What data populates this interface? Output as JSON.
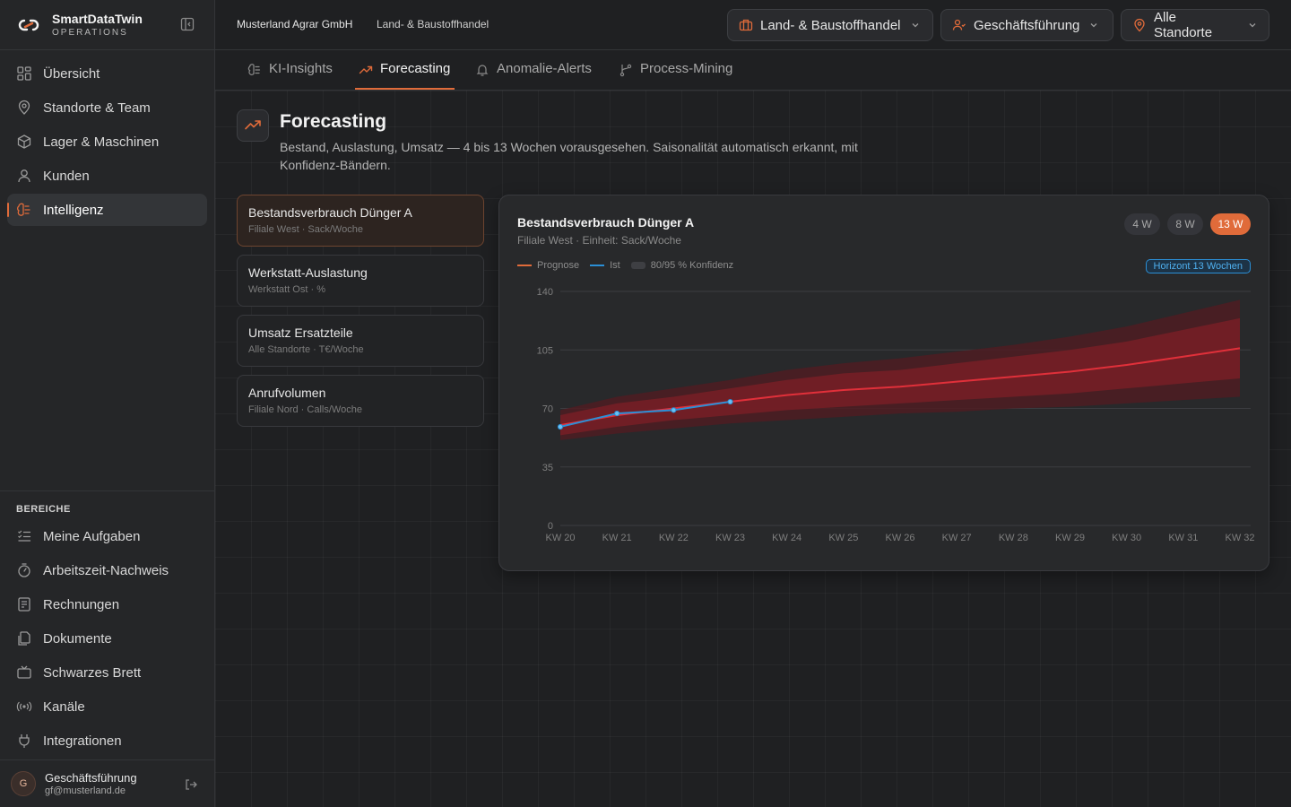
{
  "brand": {
    "name": "SmartDataTwin",
    "sub": "OPERATIONS"
  },
  "sidebar": {
    "items": [
      {
        "label": "Übersicht",
        "icon": "grid-icon"
      },
      {
        "label": "Standorte & Team",
        "icon": "map-pin-icon"
      },
      {
        "label": "Lager & Maschinen",
        "icon": "box-icon"
      },
      {
        "label": "Kunden",
        "icon": "user-icon"
      },
      {
        "label": "Intelligenz",
        "icon": "brain-icon",
        "active": true
      }
    ],
    "section_label": "BEREICHE",
    "section_items": [
      {
        "label": "Meine Aufgaben",
        "icon": "checklist-icon"
      },
      {
        "label": "Arbeitszeit-Nachweis",
        "icon": "timer-icon"
      },
      {
        "label": "Rechnungen",
        "icon": "receipt-icon"
      },
      {
        "label": "Dokumente",
        "icon": "documents-icon"
      },
      {
        "label": "Schwarzes Brett",
        "icon": "board-icon"
      },
      {
        "label": "Kanäle",
        "icon": "broadcast-icon"
      },
      {
        "label": "Integrationen",
        "icon": "plug-icon"
      }
    ],
    "user": {
      "initial": "G",
      "name": "Geschäftsführung",
      "email": "gf@musterland.de"
    }
  },
  "header": {
    "company": "Musterland Agrar GmbH",
    "segment": "Land- & Baustoffhandel",
    "selectors": {
      "branch": "Land- & Baustoffhandel",
      "role": "Geschäftsführung",
      "location": "Alle Standorte"
    }
  },
  "tabs": [
    {
      "label": "KI-Insights",
      "icon": "brain-icon"
    },
    {
      "label": "Forecasting",
      "icon": "trend-icon",
      "active": true
    },
    {
      "label": "Anomalie-Alerts",
      "icon": "bell-icon"
    },
    {
      "label": "Process-Mining",
      "icon": "git-branch-icon"
    }
  ],
  "page": {
    "title": "Forecasting",
    "description": "Bestand, Auslastung, Umsatz — 4 bis 13 Wochen vorausgesehen. Saisonalität automatisch erkannt, mit Konfidenz-Bändern."
  },
  "series_list": [
    {
      "title": "Bestandsverbrauch Dünger A",
      "sub": "Filiale West · Sack/Woche",
      "active": true
    },
    {
      "title": "Werkstatt-Auslastung",
      "sub": "Werkstatt Ost · %"
    },
    {
      "title": "Umsatz Ersatzteile",
      "sub": "Alle Standorte · T€/Woche"
    },
    {
      "title": "Anrufvolumen",
      "sub": "Filiale Nord · Calls/Woche"
    }
  ],
  "chart_panel": {
    "title": "Bestandsverbrauch Dünger A",
    "subtitle": "Filiale West · Einheit: Sack/Woche",
    "horizons": [
      "4 W",
      "8 W",
      "13 W"
    ],
    "active_horizon": "13 W",
    "horizon_badge": "Horizont 13 Wochen",
    "legend": {
      "forecast": "Prognose",
      "actual": "Ist",
      "confidence": "80/95 % Konfidenz"
    }
  },
  "colors": {
    "accent": "#e06b3a",
    "forecast": "#e0303a",
    "actual": "#2b8fd6",
    "band80": "#7a1e26",
    "band95": "#4e1c22"
  },
  "chart_data": {
    "type": "line",
    "categories": [
      "KW 20",
      "KW 21",
      "KW 22",
      "KW 23",
      "KW 24",
      "KW 25",
      "KW 26",
      "KW 27",
      "KW 28",
      "KW 29",
      "KW 30",
      "KW 31",
      "KW 32"
    ],
    "ylim": [
      0,
      140
    ],
    "yticks": [
      0,
      35,
      70,
      105,
      140
    ],
    "series": [
      {
        "name": "Prognose",
        "values": [
          60,
          66,
          70,
          74,
          78,
          81,
          83,
          86,
          89,
          92,
          96,
          101,
          106
        ]
      },
      {
        "name": "Ist",
        "values": [
          59,
          67,
          69,
          74,
          null,
          null,
          null,
          null,
          null,
          null,
          null,
          null,
          null
        ]
      }
    ],
    "band80": {
      "lower": [
        54,
        59,
        63,
        66,
        69,
        71,
        73,
        75,
        77,
        79,
        82,
        85,
        88
      ],
      "upper": [
        66,
        73,
        77,
        82,
        87,
        91,
        93,
        97,
        101,
        105,
        110,
        117,
        124
      ]
    },
    "band95": {
      "lower": [
        51,
        55,
        58,
        61,
        63,
        65,
        67,
        68,
        70,
        71,
        73,
        75,
        77
      ],
      "upper": [
        69,
        77,
        82,
        87,
        93,
        97,
        100,
        104,
        108,
        113,
        119,
        127,
        135
      ]
    },
    "grid": true
  }
}
